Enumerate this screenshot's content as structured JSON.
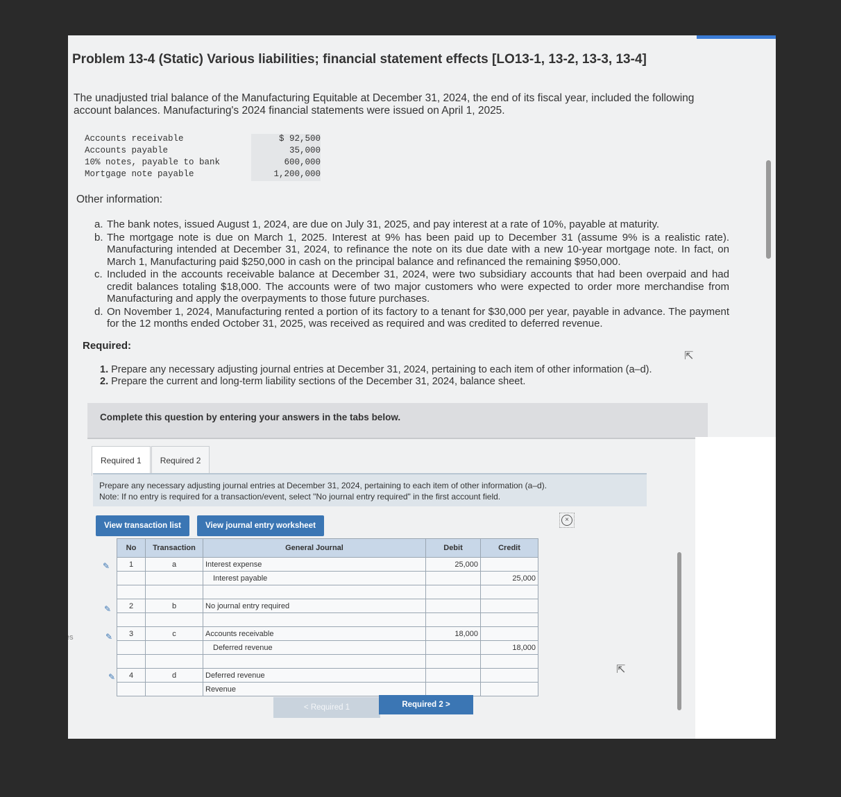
{
  "title": "Problem 13-4 (Static) Various liabilities; financial statement effects [LO13-1, 13-2, 13-3, 13-4]",
  "intro": "The unadjusted trial balance of the Manufacturing Equitable at December 31, 2024, the end of its fiscal year, included the following account balances. Manufacturing's 2024 financial statements were issued on April 1, 2025.",
  "trial_balance": [
    {
      "name": "Accounts receivable",
      "amount": "$ 92,500"
    },
    {
      "name": "Accounts payable",
      "amount": "35,000"
    },
    {
      "name": "10% notes, payable to bank",
      "amount": "600,000"
    },
    {
      "name": "Mortgage note payable",
      "amount": "1,200,000"
    }
  ],
  "other_info_label": "Other information:",
  "other_info": [
    {
      "letter": "a.",
      "text": "The bank notes, issued August 1, 2024, are due on July 31, 2025, and pay interest at a rate of 10%, payable at maturity."
    },
    {
      "letter": "b.",
      "text": "The mortgage note is due on March 1, 2025. Interest at 9% has been paid up to December 31 (assume 9% is a realistic rate). Manufacturing intended at December 31, 2024, to refinance the note on its due date with a new 10-year mortgage note. In fact, on March 1, Manufacturing paid $250,000 in cash on the principal balance and refinanced the remaining $950,000."
    },
    {
      "letter": "c.",
      "text": "Included in the accounts receivable balance at December 31, 2024, were two subsidiary accounts that had been overpaid and had credit balances totaling $18,000. The accounts were of two major customers who were expected to order more merchandise from Manufacturing and apply the overpayments to those future purchases."
    },
    {
      "letter": "d.",
      "text": "On November 1, 2024, Manufacturing rented a portion of its factory to a tenant for $30,000 per year, payable in advance. The payment for the 12 months ended October 31, 2025, was received as required and was credited to deferred revenue."
    }
  ],
  "required_label": "Required:",
  "required_items": [
    {
      "num": "1.",
      "text": "Prepare any necessary adjusting journal entries at December 31, 2024, pertaining to each item of other information (a–d)."
    },
    {
      "num": "2.",
      "text": "Prepare the current and long-term liability sections of the December 31, 2024, balance sheet."
    }
  ],
  "complete_text": "Complete this question by entering your answers in the tabs below.",
  "tabs": [
    "Required 1",
    "Required 2"
  ],
  "instructions": {
    "line1": "Prepare any necessary adjusting journal entries at December 31, 2024, pertaining to each item of other information (a–d).",
    "line2": "Note: If no entry is required for a transaction/event, select \"No journal entry required\" in the first account field."
  },
  "buttons": {
    "view_transactions": "View transaction list",
    "view_worksheet": "View journal entry worksheet",
    "prev": "< Required 1",
    "next": "Required 2 >"
  },
  "journal": {
    "headers": {
      "no": "No",
      "transaction": "Transaction",
      "general_journal": "General Journal",
      "debit": "Debit",
      "credit": "Credit"
    },
    "rows": [
      {
        "no": "1",
        "txn": "a",
        "account": "Interest expense",
        "debit": "25,000",
        "credit": ""
      },
      {
        "no": "",
        "txn": "",
        "account": "Interest payable",
        "debit": "",
        "credit": "25,000"
      },
      {
        "no": "2",
        "txn": "b",
        "account": "No journal entry required",
        "debit": "",
        "credit": ""
      },
      {
        "no": "3",
        "txn": "c",
        "account": "Accounts receivable",
        "debit": "18,000",
        "credit": ""
      },
      {
        "no": "",
        "txn": "",
        "account": "Deferred revenue",
        "debit": "",
        "credit": "18,000"
      },
      {
        "no": "4",
        "txn": "d",
        "account": "Deferred revenue",
        "debit": "",
        "credit": ""
      },
      {
        "no": "",
        "txn": "",
        "account": "Revenue",
        "debit": "",
        "credit": ""
      }
    ]
  },
  "sidebar_fragment": "es"
}
